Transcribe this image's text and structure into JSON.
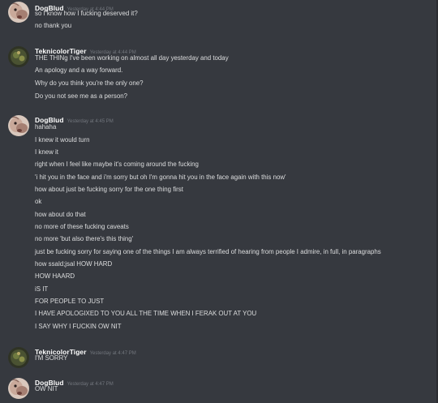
{
  "groups": [
    {
      "username": "DogBlud",
      "timestamp": "Yesterday at 4:44 PM",
      "avatar": "dogblud-avatar",
      "lines": [
        "so I know how I fucking deserved it?",
        "no thank you"
      ]
    },
    {
      "username": "TeknicolorTiger",
      "timestamp": "Yesterday at 4:44 PM",
      "avatar": "teknicolortiger-avatar",
      "lines": [
        "THE THINg I've been working on almost all day yesterday and today",
        "An apology and a way forward.",
        "Why do you think you're the only one?",
        "Do you not see me as a person?"
      ]
    },
    {
      "username": "DogBlud",
      "timestamp": "Yesterday at 4:45 PM",
      "avatar": "dogblud-avatar",
      "lines": [
        "hahaha",
        "I knew it would turn",
        "I knew it",
        "right when I feel like maybe it's coming around the fucking",
        "'i hit you in the face and i'm sorry but oh I'm gonna hit you in the face again with this now'",
        "how about just be fucking sorry for the one thing first",
        "ok",
        "how about do that",
        "no more of these fucking caveats",
        "no more 'but also there's this thing'",
        "just be fucking sorry for saying one of the things I am always terrified of hearing from people I admire, in full, in paragraphs",
        "how ssald;jsal HOW HARD",
        "HOW HAARD",
        "iS IT",
        "FOR PEOPLE TO JUST",
        "I HAVE APOLOGIXED TO YOU ALL THE TIME WHEN I FERAK OUT AT YOU",
        "I SAY WHY I FUCKIN OW NIT"
      ]
    },
    {
      "username": "TeknicolorTiger",
      "timestamp": "Yesterday at 4:47 PM",
      "avatar": "teknicolortiger-avatar",
      "lines": [
        "I'M SORRY"
      ]
    },
    {
      "username": "DogBlud",
      "timestamp": "Yesterday at 4:47 PM",
      "avatar": "dogblud-avatar",
      "lines": [
        "OW NIT"
      ]
    }
  ],
  "colors": {
    "background": "#36393f",
    "username": "#ffffff",
    "timestamp": "#72767d",
    "text": "#dcddde"
  }
}
